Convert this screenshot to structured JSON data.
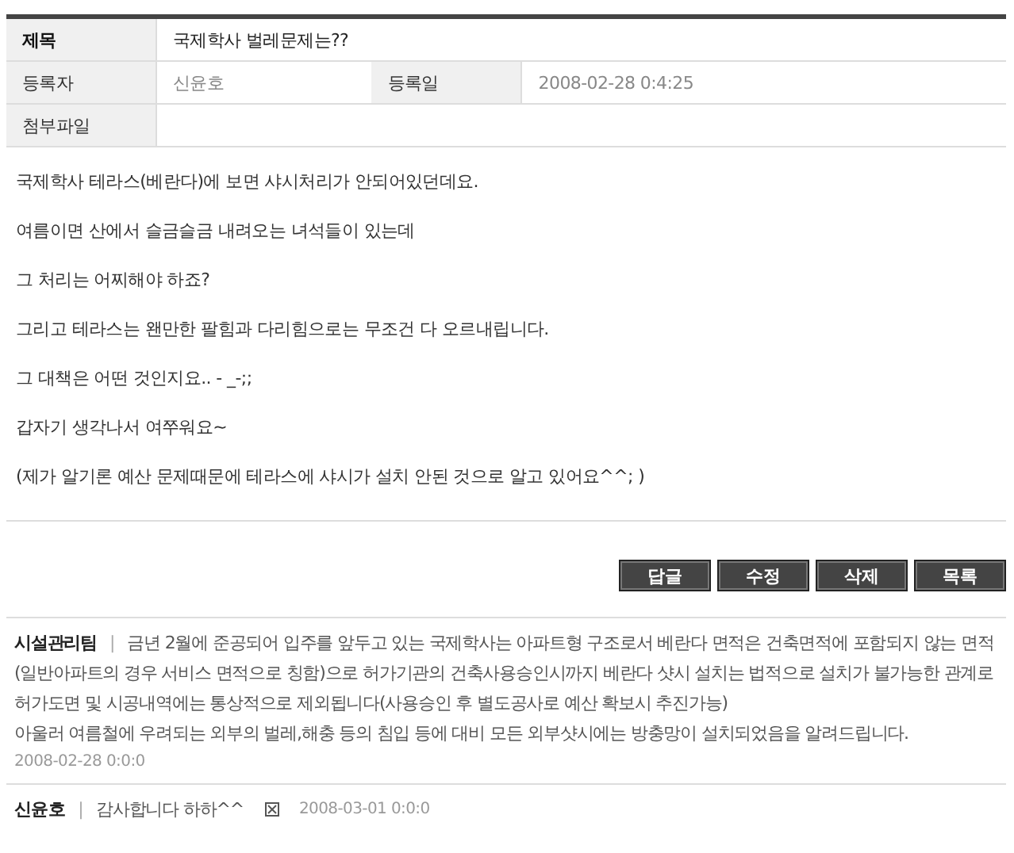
{
  "info_table": {
    "rows": [
      {
        "cells": [
          {
            "label": "제목",
            "value": "국제학사 벌레문제는??",
            "bold_label": true
          }
        ]
      },
      {
        "cells": [
          {
            "label": "등록자",
            "value": "신윤호"
          },
          {
            "label": "등록일",
            "value": "2008-02-28 0:4:25"
          }
        ]
      },
      {
        "cells": [
          {
            "label": "첨부파일"
          }
        ]
      }
    ]
  },
  "body": [
    "국제학사 테라스(베란다)에 보면 샤시처리가 안되어있던데요.",
    "여름이면 산에서 슬금슬금 내려오는 녀석들이 있는데",
    "그 처리는 어찌해야 하죠?",
    "그리고 테라스는 왠만한 팔힘과 다리힘으로는 무조건 다 오르내립니다.",
    "그 대책은 어떤 것인지요.. - _-;;",
    "갑자기 생각나서 여쭈워요~",
    "(제가 알기론 예산 문제때문에 테라스에 샤시가 설치 안된 것으로 알고 있어요^^; )"
  ],
  "buttons": [
    "답글",
    "수정",
    "삭제",
    "목록"
  ],
  "comment_separator": "|",
  "comments": [
    {
      "author": "시설관리팀",
      "text": "금년 2월에 준공되어 입주를 앞두고 있는 국제학사는 아파트형 구조로서 베란다 면적은 건축면적에 포함되지 않는 면적(일반아파트의 경우 서비스 면적으로 칭함)으로 허가기관의 건축사용승인시까지 베란다 샷시 설치는 법적으로 설치가 불가능한 관계로 허가도면 및 시공내역에는 통상적으로 제외됩니다(사용승인 후 별도공사로 예산 확보시 추진가능)\n아울러 여름철에 우려되는 외부의 벌레,해충 등의 침입 등에 대비 모든 외부샷시에는 방충망이 설치되었음을 알려드립니다.",
      "date": "2008-02-28 0:0:0"
    },
    {
      "author": "신윤호",
      "text": "감사합니다 하하^^",
      "date": "2008-03-01 0:0:0",
      "deletable": true
    }
  ]
}
